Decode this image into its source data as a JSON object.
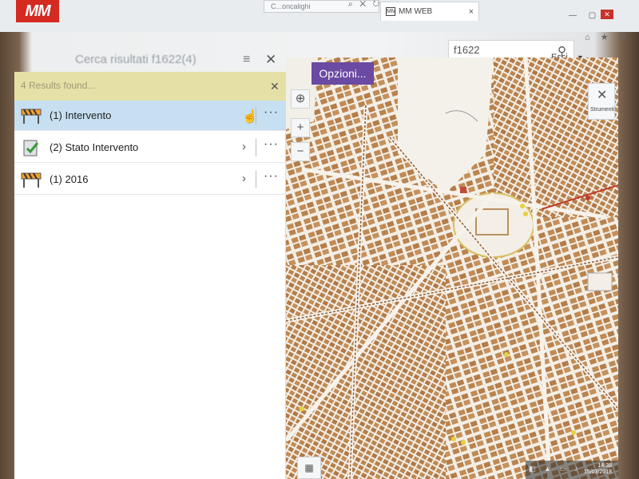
{
  "browser": {
    "url_text": "C...oncalighi",
    "tab_title": "MM WEB",
    "tab_favicon": "MM"
  },
  "app": {
    "logo": "MM",
    "panel_title": "Cerca risultati f1622(4)",
    "search_value": "f1622",
    "logout_label": "Esci"
  },
  "results_bar": {
    "text": "4 Results found..."
  },
  "results": [
    {
      "label": "(1) Intervento",
      "selected": true,
      "icon": "barrier-icon"
    },
    {
      "label": "(2) Stato Intervento",
      "selected": false,
      "icon": "clipboard-check-icon"
    },
    {
      "label": "(1) 2016",
      "selected": false,
      "icon": "barrier-icon"
    }
  ],
  "map": {
    "options_button": "Opzioni...",
    "tools_label": "Strumenti"
  },
  "taskbar": {
    "time": "14:38",
    "date": "15/03/2018"
  },
  "colors": {
    "brand_red": "#d52a21",
    "accent_purple": "#6a4aa2",
    "results_yellow": "#e5e1a6",
    "selected_row": "#c6dff1"
  }
}
